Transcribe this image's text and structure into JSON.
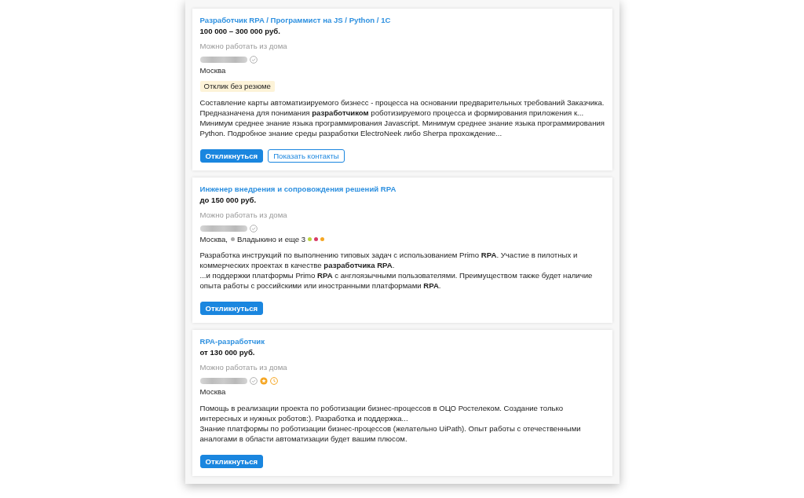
{
  "vacancies": [
    {
      "title": "Разработчик RPA / Программист на JS / Python / 1С",
      "salary": "100 000 – 300 000 руб.",
      "remote": "Можно работать из дома",
      "company_verified": true,
      "location": {
        "city": "Москва"
      },
      "response_badge": "Отклик без резюме",
      "snippets": [
        "Составление карты автоматизируемого бизнесс - процесса на основании предварительных требований Заказчика. Предназначена для понимания **разработчиком** роботизируемого процесса и формирования приложения к...",
        "Минимум среднее знание языка программирования Javascript. Минимум среднее знание языка программирования Python. Подробное знание среды разработки ElectroNeek либо Sherpa прохождение..."
      ],
      "buttons": [
        {
          "label": "Откликнуться",
          "kind": "primary"
        },
        {
          "label": "Показать контакты",
          "kind": "outline"
        }
      ]
    },
    {
      "title": "Инженер внедрения и сопровождения решений RPA",
      "salary": "до 150 000 руб.",
      "remote": "Можно работать из дома",
      "company_verified": true,
      "location": {
        "city": "Москва,",
        "metro": {
          "station": "Владыкино и еще 3",
          "color": "#a8a8a8"
        },
        "more_lines": [
          {
            "color": "#bcd33c"
          },
          {
            "color": "#d83a66"
          },
          {
            "color": "#f5a623"
          }
        ]
      },
      "snippets": [
        "Разработка инструкций по выполнению типовых задач с использованием Primo **RPA**. Участие в пилотных и коммерческих проектах в качестве **разработчика RPA**.",
        "...и поддержки платформы Primo **RPA** с англоязычными пользователями. Преимуществом также будет наличие опыта работы с российскими или иностранными платформами **RPA**."
      ],
      "buttons": [
        {
          "label": "Откликнуться",
          "kind": "primary"
        }
      ]
    },
    {
      "title": "RPA-разработчик",
      "salary": "от 130 000 руб.",
      "remote": "Можно работать из дома",
      "company_verified": true,
      "company_badges": [
        {
          "kind": "award"
        },
        {
          "kind": "clock"
        }
      ],
      "location": {
        "city": "Москва"
      },
      "snippets": [
        "Помощь в реализации проекта по роботизации бизнес-процессов в ОЦО Ростелеком. Создание только интересных и нужных роботов:). Разработка и поддержка...",
        "Знание платформы по роботизации бизнес-процессов (желательно UiPath). Опыт работы с отечественными аналогами в области автоматизации будет вашим плюсом."
      ],
      "buttons": [
        {
          "label": "Откликнуться",
          "kind": "primary"
        }
      ]
    }
  ]
}
